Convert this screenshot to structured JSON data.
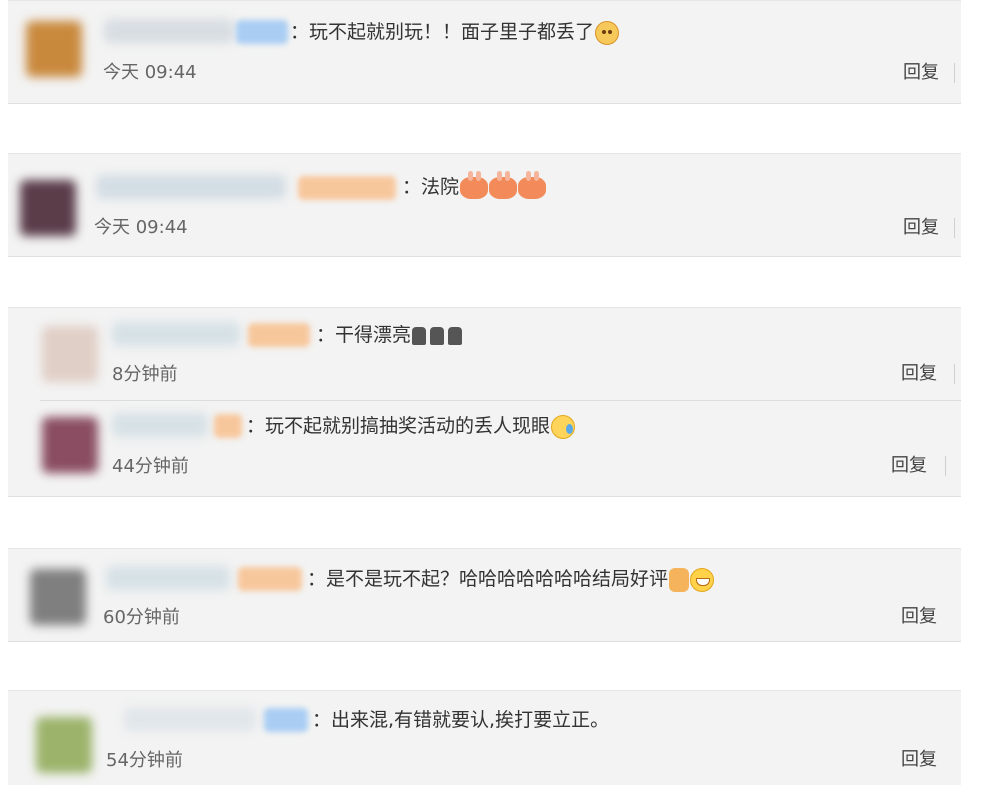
{
  "comments": [
    {
      "text": "：玩不起就别玩！！面子里子都丢了",
      "time": "今天 09:44",
      "reply": "回复",
      "emoji": "cat-face-emoji"
    },
    {
      "text": "：法院",
      "time": "今天 09:44",
      "reply": "回复",
      "emoji": "rabbit-emoji"
    },
    {
      "text": "：干得漂亮",
      "time": "8分钟前",
      "reply": "回复",
      "emoji": "clap-emoji"
    },
    {
      "text": "：玩不起就别搞抽奖活动的丢人现眼",
      "time": "44分钟前",
      "reply": "回复",
      "emoji": "sweat-smile-emoji"
    },
    {
      "text": "：是不是玩不起？哈哈哈哈哈哈哈结局好评",
      "time": "60分钟前",
      "reply": "回复",
      "emoji": "thumbs-up-grin-emoji"
    },
    {
      "text": "：出来混,有错就要认,挨打要立正。",
      "time": "54分钟前",
      "reply": "回复",
      "emoji": ""
    }
  ],
  "colors": {
    "card_bg": "#f3f3f3",
    "text": "#333333",
    "time": "#666666",
    "tag_blue": "#a9cdf3",
    "tag_orange": "#f7c79c"
  }
}
